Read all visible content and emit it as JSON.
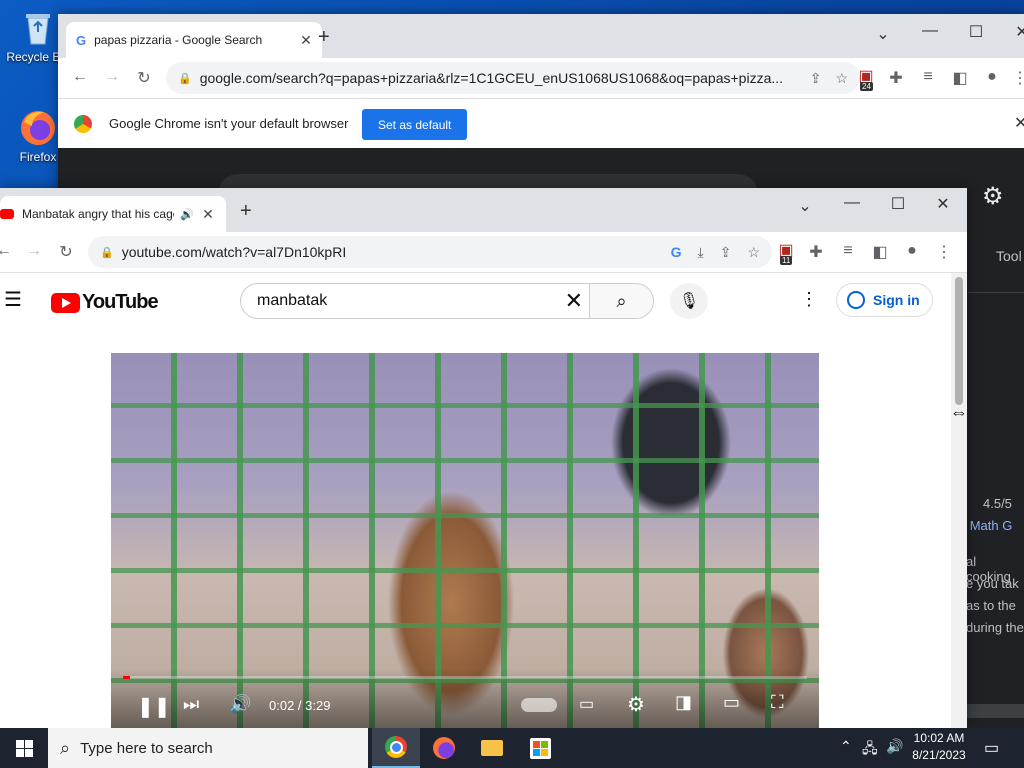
{
  "desktop": {
    "icons": [
      {
        "label": "Recycle Bin"
      },
      {
        "label": "Firefox"
      }
    ]
  },
  "back_window": {
    "tab_title": "papas pizzaria - Google Search",
    "url": "google.com/search?q=papas+pizzaria&rlz=1C1GCEU_enUS1068US1068&oq=papas+pizza...",
    "ext_badge": "24",
    "infobar_text": "Google Chrome isn't your default browser",
    "set_default_label": "Set as default",
    "right_content": {
      "tools": "Tool",
      "rating": "4.5/5",
      "link": "ol Math G",
      "lines": [
        "al cooking",
        "e you tak",
        "as to the",
        "during the"
      ]
    }
  },
  "front_window": {
    "tab_title": "Manbatak angry that his cage",
    "url": "youtube.com/watch?v=al7Dn10kpRI",
    "ext_badge": "11",
    "youtube": {
      "logo_text": "YouTube",
      "search_value": "manbatak",
      "sign_in_label": "Sign in"
    },
    "player": {
      "time": "0:02 / 3:29",
      "progress": 0.01
    }
  },
  "taskbar": {
    "search_placeholder": "Type here to search",
    "time": "10:02 AM",
    "date": "8/21/2023"
  },
  "colors": {
    "chrome_blue": "#1a73e8",
    "youtube_red": "#ff0000",
    "taskbar_bg": "#1d2430"
  }
}
